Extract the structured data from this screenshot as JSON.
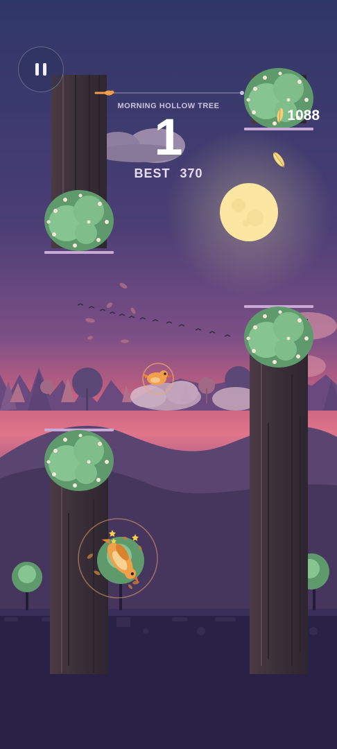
{
  "hud": {
    "pause_icon": "pause-icon",
    "level_name": "MORNING HOLLOW TREE",
    "score": "1",
    "best_label": "BEST",
    "best_value": "370",
    "feathers": "1088",
    "feather_icon": "feather-icon",
    "progress": 0.07
  },
  "colors": {
    "sky_top": "#2f3766",
    "sky_mid": "#7c4f86",
    "sky_glow": "#e0758a",
    "moon": "#fbe6a2",
    "trunk": "#3c3038",
    "foliage": "#7fbe8b",
    "bird": "#f0a04b",
    "ground": "#2a2246"
  }
}
